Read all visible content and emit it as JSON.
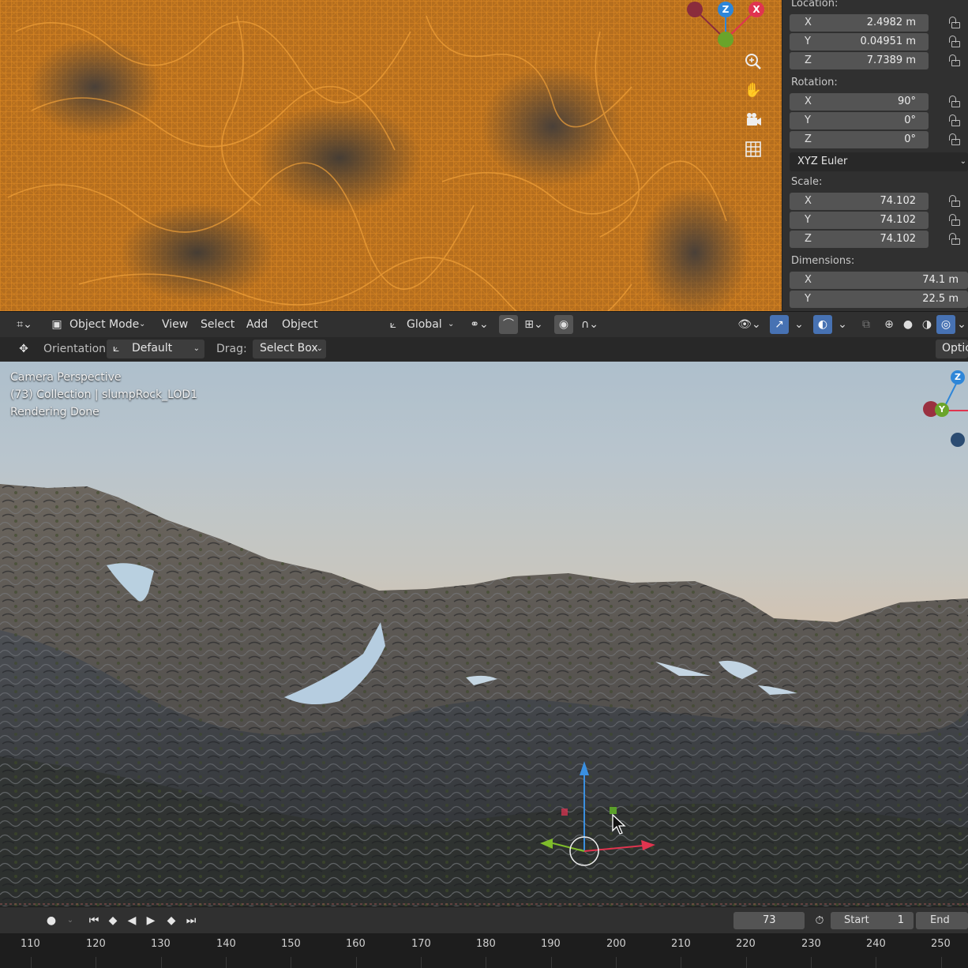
{
  "properties": {
    "location_label": "Location:",
    "location": [
      {
        "axis": "X",
        "value": "2.4982 m"
      },
      {
        "axis": "Y",
        "value": "0.04951 m"
      },
      {
        "axis": "Z",
        "value": "7.7389 m"
      }
    ],
    "rotation_label": "Rotation:",
    "rotation": [
      {
        "axis": "X",
        "value": "90°"
      },
      {
        "axis": "Y",
        "value": "0°"
      },
      {
        "axis": "Z",
        "value": "0°"
      }
    ],
    "rotation_mode": "XYZ Euler",
    "scale_label": "Scale:",
    "scale": [
      {
        "axis": "X",
        "value": "74.102"
      },
      {
        "axis": "Y",
        "value": "74.102"
      },
      {
        "axis": "Z",
        "value": "74.102"
      }
    ],
    "dimensions_label": "Dimensions:",
    "dimensions": [
      {
        "axis": "X",
        "value": "74.1 m"
      },
      {
        "axis": "Y",
        "value": "22.5 m"
      }
    ]
  },
  "top_gizmo": {
    "z": "Z",
    "x": "X"
  },
  "header": {
    "mode": "Object Mode",
    "menus": [
      "View",
      "Select",
      "Add",
      "Object"
    ],
    "transform_orientation": "Global"
  },
  "tool_header": {
    "orientation_label": "Orientation:",
    "orientation_value": "Default",
    "drag_label": "Drag:",
    "drag_value": "Select Box",
    "options_label": "Optic"
  },
  "viewport": {
    "overlay_lines": [
      "Camera Perspective",
      "(73) Collection | slumpRock_LOD1",
      "Rendering Done"
    ],
    "gizmo": {
      "z": "Z",
      "y": "Y"
    }
  },
  "timeline": {
    "current_frame": "73",
    "start_label": "Start",
    "start_value": "1",
    "end_label": "End",
    "ruler": [
      "110",
      "120",
      "130",
      "140",
      "150",
      "160",
      "170",
      "180",
      "190",
      "200",
      "210",
      "220",
      "230",
      "240",
      "250"
    ]
  },
  "colors": {
    "accent": "#4772b3",
    "axis_x": "#e0344f",
    "axis_y": "#7fbc2b",
    "axis_z": "#2e86d8",
    "wireframe": "#e08a1e"
  },
  "icons": [
    "zoom-icon",
    "hand-pan-icon",
    "camera-icon",
    "grid-icon",
    "lock-icon",
    "play-icon"
  ]
}
